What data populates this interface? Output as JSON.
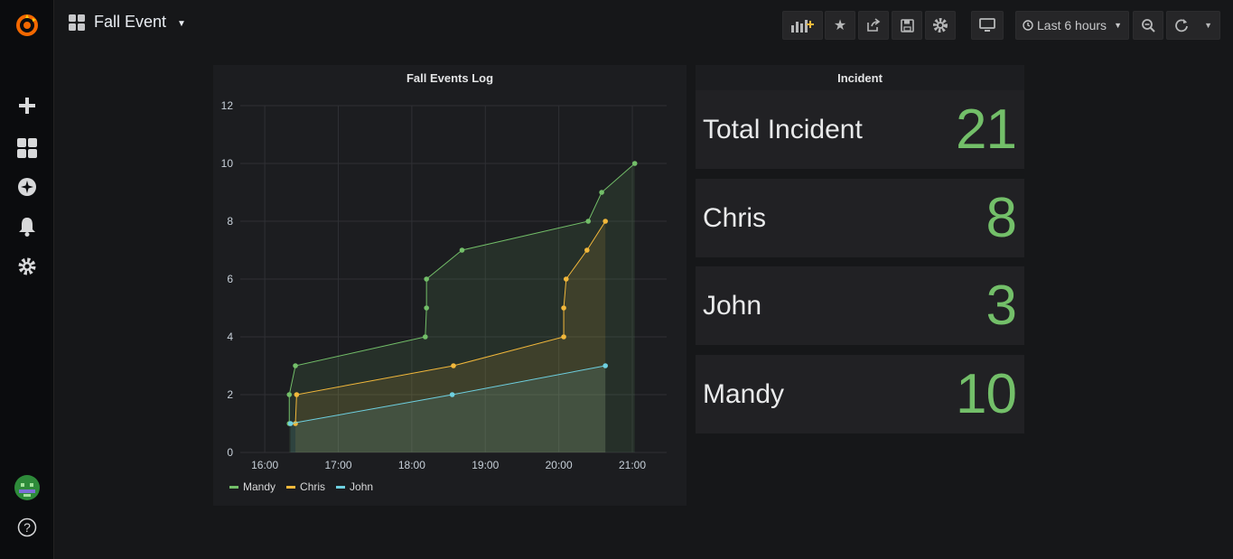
{
  "dashboard": {
    "title": "Fall Event"
  },
  "toolbar": {
    "time_range": "Last 6 hours"
  },
  "colors": {
    "green": "#73bf69",
    "yellow": "#f2b83b",
    "cyan": "#6ed0e0",
    "brand": "#f46800"
  },
  "sidebar": {
    "items": [
      {
        "icon": "plus-icon"
      },
      {
        "icon": "dashboards-icon"
      },
      {
        "icon": "explore-icon"
      },
      {
        "icon": "bell-icon"
      },
      {
        "icon": "gear-icon"
      },
      {
        "icon": "avatar"
      },
      {
        "icon": "help-icon"
      }
    ],
    "help_label": "?"
  },
  "panels": {
    "graph_title": "Fall Events Log",
    "incident_title": "Incident"
  },
  "stats": [
    {
      "label": "Total Incident",
      "value": "21"
    },
    {
      "label": "Chris",
      "value": "8"
    },
    {
      "label": "John",
      "value": "3"
    },
    {
      "label": "Mandy",
      "value": "10"
    }
  ],
  "chart_data": {
    "type": "line",
    "title": "Fall Events Log",
    "xlabel": "",
    "ylabel": "",
    "x_ticks": [
      "16:00",
      "17:00",
      "18:00",
      "19:00",
      "20:00",
      "21:00"
    ],
    "y_ticks": [
      "0",
      "2",
      "4",
      "6",
      "8",
      "10",
      "12"
    ],
    "ylim": [
      0,
      12
    ],
    "xlim": [
      "15:40",
      "21:28"
    ],
    "grid": true,
    "legend_position": "bottom-left",
    "series": [
      {
        "name": "Mandy",
        "color": "#73bf69",
        "points": [
          [
            "16:20",
            1
          ],
          [
            "16:20",
            2
          ],
          [
            "16:25",
            3
          ],
          [
            "18:11",
            4
          ],
          [
            "18:12",
            5
          ],
          [
            "18:12",
            6
          ],
          [
            "18:41",
            7
          ],
          [
            "20:24",
            8
          ],
          [
            "20:35",
            9
          ],
          [
            "21:02",
            10
          ]
        ]
      },
      {
        "name": "Chris",
        "color": "#f2b83b",
        "points": [
          [
            "16:25",
            1
          ],
          [
            "16:26",
            2
          ],
          [
            "18:34",
            3
          ],
          [
            "20:04",
            4
          ],
          [
            "20:04",
            5
          ],
          [
            "20:06",
            6
          ],
          [
            "20:23",
            7
          ],
          [
            "20:38",
            8
          ]
        ]
      },
      {
        "name": "John",
        "color": "#6ed0e0",
        "points": [
          [
            "16:21",
            1
          ],
          [
            "18:33",
            2
          ],
          [
            "20:38",
            3
          ]
        ]
      }
    ]
  }
}
